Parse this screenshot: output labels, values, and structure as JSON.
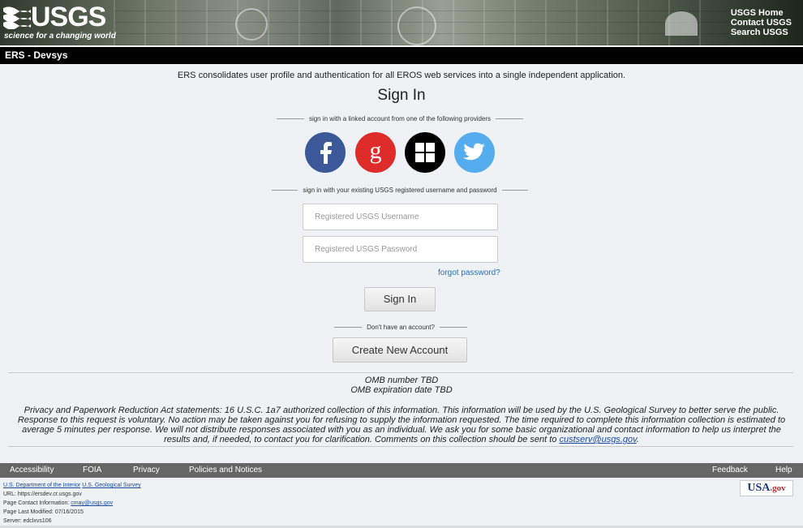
{
  "header": {
    "logo_text": "USGS",
    "logo_tagline": "science for a changing world",
    "links": [
      "USGS Home",
      "Contact USGS",
      "Search USGS"
    ]
  },
  "titlebar": {
    "title": "ERS - Devsys"
  },
  "main": {
    "intro": "ERS consolidates user profile and authentication for all EROS web services into a single independent application.",
    "heading": "Sign In",
    "providers_label": "sign in with a linked account from one of the following providers",
    "providers": [
      {
        "name": "facebook",
        "color": "#3b5998"
      },
      {
        "name": "google",
        "color": "#dd2c2a"
      },
      {
        "name": "windows",
        "color": "#000000"
      },
      {
        "name": "twitter",
        "color": "#55acee"
      }
    ],
    "credentials_label": "sign in with your existing USGS registered username and password",
    "username_placeholder": "Registered USGS Username",
    "password_placeholder": "Registered USGS Password",
    "forgot": "forgot password?",
    "signin_button": "Sign In",
    "no_account": "Don't have an account?",
    "create_button": "Create New Account",
    "omb_number": "OMB number TBD",
    "omb_expiration": "OMB expiration date TBD",
    "privacy_text": "Privacy and Paperwork Reduction Act statements: 16 U.S.C. 1a7 authorized collection of this information. This information will be used by the U.S. Geological Survey to better serve the public. Response to this request is voluntary. No action may be taken against you for refusing to supply the information requested. The time required to complete this information collection is estimated to average 5 minutes per response. We will not distribute responses associated with you as an individual. We ask you for some basic organizational and contact information to help us interpret the results and, if needed, to contact you for clarification. Comments on this collection should be sent to ",
    "privacy_email": "custserv@usgs.gov",
    "privacy_end": "."
  },
  "footer": {
    "left_links": [
      "Accessibility",
      "FOIA",
      "Privacy",
      "Policies and Notices"
    ],
    "right_links": [
      "Feedback",
      "Help"
    ],
    "doi_link": "U.S. Department of the Interior",
    "usgs_link": "U.S. Geological Survey",
    "url": "URL: https://ersdev.cr.usgs.gov",
    "contact_label": "Page Contact Information: ",
    "contact_email": "cmay@usgs.gov",
    "modified": "Page Last Modified: 07/16/2015",
    "server": "Server: edclxvs106",
    "usagov_usa": "USA",
    "usagov_gov": ".gov"
  }
}
